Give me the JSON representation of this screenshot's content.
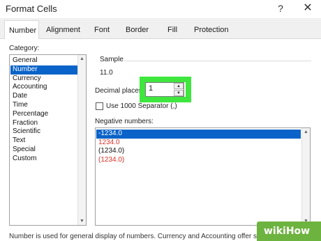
{
  "window": {
    "title": "Format Cells",
    "help": "?",
    "close": "✕"
  },
  "tabs": [
    "Number",
    "Alignment",
    "Font",
    "Border",
    "Fill",
    "Protection"
  ],
  "category": {
    "label": "Category:",
    "items": [
      "General",
      "Number",
      "Currency",
      "Accounting",
      "Date",
      "Time",
      "Percentage",
      "Fraction",
      "Scientific",
      "Text",
      "Special",
      "Custom"
    ],
    "selected": "Number"
  },
  "sample": {
    "label": "Sample",
    "value": "11.0"
  },
  "decimal_places": {
    "label": "Decimal places:",
    "value": "1"
  },
  "separator": {
    "label": "Use 1000 Separator (,)",
    "checked": false
  },
  "negative_numbers": {
    "label": "Negative numbers:",
    "items": [
      "-1234.0",
      "1234.0",
      "(1234.0)",
      "(1234.0)"
    ],
    "selected_index": 0
  },
  "description": "Number is used for general display of numbers. Currency and Accounting offer specialized",
  "watermark": {
    "brand": "wikiHow",
    "color": "#6db33f"
  },
  "colors": {
    "accent": "#0a63c8",
    "highlight": "#3ee63e",
    "negative": "#d93025"
  }
}
